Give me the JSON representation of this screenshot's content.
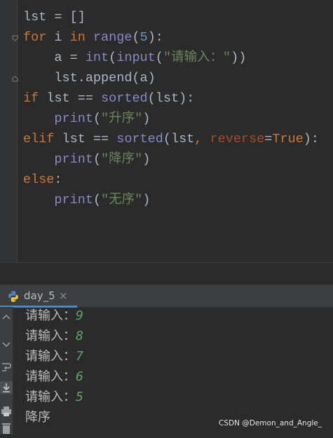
{
  "editor": {
    "lines": [
      [
        {
          "t": "lst = []",
          "c": ""
        }
      ],
      [
        {
          "t": "for",
          "c": "kw"
        },
        {
          "t": " i ",
          "c": ""
        },
        {
          "t": "in",
          "c": "kw"
        },
        {
          "t": " ",
          "c": ""
        },
        {
          "t": "range",
          "c": "fn"
        },
        {
          "t": "(",
          "c": ""
        },
        {
          "t": "5",
          "c": "num"
        },
        {
          "t": "):",
          "c": ""
        }
      ],
      [
        {
          "t": "    a = ",
          "c": ""
        },
        {
          "t": "int",
          "c": "fn"
        },
        {
          "t": "(",
          "c": ""
        },
        {
          "t": "input",
          "c": "fn"
        },
        {
          "t": "(",
          "c": ""
        },
        {
          "t": "\"请输入：\"",
          "c": "str"
        },
        {
          "t": "))",
          "c": ""
        }
      ],
      [
        {
          "t": "    lst.append(a)",
          "c": ""
        }
      ],
      [
        {
          "t": "if",
          "c": "kw"
        },
        {
          "t": " lst == ",
          "c": ""
        },
        {
          "t": "sorted",
          "c": "fn"
        },
        {
          "t": "(lst):",
          "c": ""
        }
      ],
      [
        {
          "t": "    ",
          "c": ""
        },
        {
          "t": "print",
          "c": "fn"
        },
        {
          "t": "(",
          "c": ""
        },
        {
          "t": "\"升序\"",
          "c": "str"
        },
        {
          "t": ")",
          "c": ""
        }
      ],
      [
        {
          "t": "elif",
          "c": "kw"
        },
        {
          "t": " lst == ",
          "c": ""
        },
        {
          "t": "sorted",
          "c": "fn"
        },
        {
          "t": "(lst",
          "c": ""
        },
        {
          "t": ", ",
          "c": "kw"
        },
        {
          "t": "reverse",
          "c": "param"
        },
        {
          "t": "=",
          "c": ""
        },
        {
          "t": "True",
          "c": "kw"
        },
        {
          "t": "):",
          "c": ""
        }
      ],
      [
        {
          "t": "    ",
          "c": ""
        },
        {
          "t": "print",
          "c": "fn"
        },
        {
          "t": "(",
          "c": ""
        },
        {
          "t": "\"降序\"",
          "c": "str"
        },
        {
          "t": ")",
          "c": ""
        }
      ],
      [
        {
          "t": "else",
          "c": "kw"
        },
        {
          "t": ":",
          "c": ""
        }
      ],
      [
        {
          "t": "    ",
          "c": ""
        },
        {
          "t": "print",
          "c": "fn"
        },
        {
          "t": "(",
          "c": ""
        },
        {
          "t": "\"无序\"",
          "c": "str"
        },
        {
          "t": ")",
          "c": ""
        }
      ]
    ]
  },
  "run_panel": {
    "tab_label": "day_5",
    "close_glyph": "×",
    "side_icons": [
      "up-arrow-icon",
      "down-arrow-icon",
      "soft-wrap-icon",
      "scroll-to-end-icon",
      "print-icon",
      "trash-icon"
    ],
    "output": [
      {
        "prompt": "请输入：",
        "input": "9"
      },
      {
        "prompt": "请输入：",
        "input": "8"
      },
      {
        "prompt": "请输入：",
        "input": "7"
      },
      {
        "prompt": "请输入：",
        "input": "6"
      },
      {
        "prompt": "请输入：",
        "input": "5"
      },
      {
        "prompt": "降序",
        "input": ""
      }
    ]
  },
  "watermark": "CSDN @Demon_and_Angle_"
}
